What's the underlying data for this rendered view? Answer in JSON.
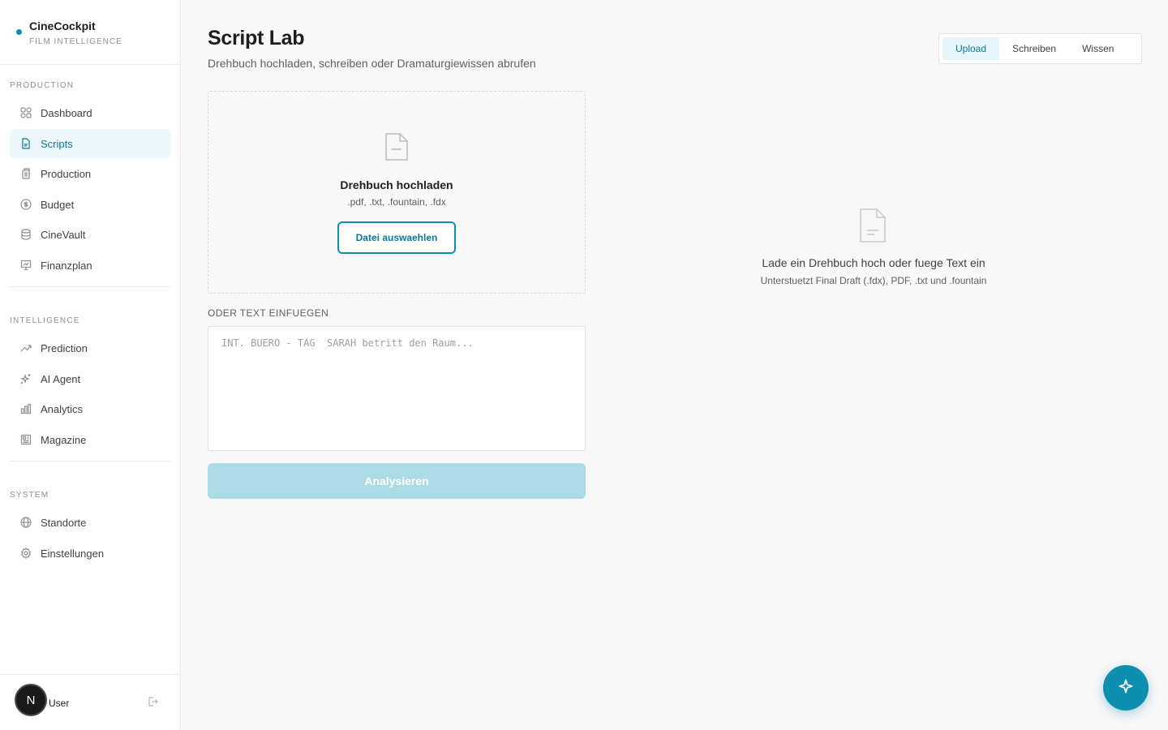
{
  "brand": {
    "name": "CineCockpit",
    "subtitle": "FILM INTELLIGENCE"
  },
  "sidebar": {
    "sections": [
      {
        "label": "PRODUCTION",
        "items": [
          {
            "label": "Dashboard",
            "icon": "grid-icon"
          },
          {
            "label": "Scripts",
            "icon": "document-icon",
            "active": true
          },
          {
            "label": "Production",
            "icon": "clapper-icon"
          },
          {
            "label": "Budget",
            "icon": "dollar-icon"
          },
          {
            "label": "CineVault",
            "icon": "database-icon"
          },
          {
            "label": "Finanzplan",
            "icon": "presentation-icon"
          }
        ]
      },
      {
        "label": "INTELLIGENCE",
        "items": [
          {
            "label": "Prediction",
            "icon": "trending-up-icon"
          },
          {
            "label": "AI Agent",
            "icon": "sparkles-icon"
          },
          {
            "label": "Analytics",
            "icon": "bar-chart-icon"
          },
          {
            "label": "Magazine",
            "icon": "newspaper-icon"
          }
        ]
      },
      {
        "label": "SYSTEM",
        "items": [
          {
            "label": "Standorte",
            "icon": "globe-icon"
          },
          {
            "label": "Einstellungen",
            "icon": "gear-icon"
          }
        ]
      }
    ]
  },
  "user": {
    "initial": "N",
    "name": "User"
  },
  "main": {
    "title": "Script Lab",
    "subtitle": "Drehbuch hochladen, schreiben oder Dramaturgiewissen abrufen",
    "tabs": [
      {
        "label": "Upload",
        "active": true
      },
      {
        "label": "Schreiben"
      },
      {
        "label": "Wissen"
      }
    ],
    "dropzone": {
      "title": "Drehbuch hochladen",
      "types": ".pdf, .txt, .fountain, .fdx",
      "button": "Datei auswaehlen"
    },
    "paste_label": "ODER TEXT EINFUEGEN",
    "textarea_placeholder": "INT. BUERO - TAG  SARAH betritt den Raum...",
    "analyze_button": "Analysieren",
    "empty_state": {
      "title": "Lade ein Drehbuch hoch oder fuege Text ein",
      "subtitle": "Unterstuetzt Final Draft (.fdx), PDF, .txt und .fountain"
    }
  },
  "colors": {
    "accent": "#0e8fb0",
    "active_bg": "#eef8fb",
    "button_disabled": "#acdbe6"
  }
}
